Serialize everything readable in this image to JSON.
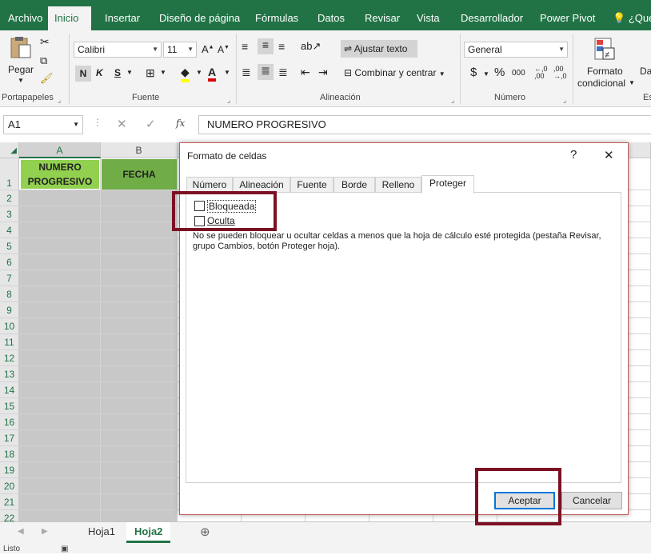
{
  "ribbon": {
    "tabs": [
      "Archivo",
      "Inicio",
      "Insertar",
      "Diseño de página",
      "Fórmulas",
      "Datos",
      "Revisar",
      "Vista",
      "Desarrollador",
      "Power Pivot",
      "¿Qué"
    ],
    "active_tab": "Inicio",
    "clipboard": {
      "paste_label": "Pegar",
      "group": "Portapapeles"
    },
    "font": {
      "name": "Calibri",
      "size": "11",
      "bold": "N",
      "italic": "K",
      "underline": "S",
      "group": "Fuente"
    },
    "alignment": {
      "wrap_text": "Ajustar texto",
      "merge_center": "Combinar y centrar",
      "group": "Alineación"
    },
    "number": {
      "format": "General",
      "currency": "$",
      "percent": "%",
      "thousands": "000",
      "inc_decimal": ",0\n,00",
      "group": "Número"
    },
    "styles": {
      "cond_format_1": "Formato",
      "cond_format_2": "condicional",
      "next_1": "Da",
      "next_group": "Es"
    }
  },
  "formula_bar": {
    "name_box": "A1",
    "fx": "fx",
    "value": "NUMERO PROGRESIVO"
  },
  "grid": {
    "columns": [
      "A",
      "B"
    ],
    "rows": [
      "1",
      "2",
      "3",
      "4",
      "5",
      "6",
      "7",
      "8",
      "9",
      "10",
      "11",
      "12",
      "13",
      "14",
      "15",
      "16",
      "17",
      "18",
      "19",
      "20",
      "21",
      "22"
    ],
    "a1": "NUMERO PROGRESIVO",
    "b1": "FECHA"
  },
  "sheets": {
    "tabs": [
      "Hoja1",
      "Hoja2"
    ],
    "active": "Hoja2",
    "status": "Listo"
  },
  "dialog": {
    "title": "Formato de celdas",
    "help": "?",
    "close": "✕",
    "tabs": [
      "Número",
      "Alineación",
      "Fuente",
      "Borde",
      "Relleno",
      "Proteger"
    ],
    "active_tab": "Proteger",
    "locked_label": "Bloqueada",
    "hidden_label": "Oculta",
    "note": "No se pueden bloquear u ocultar celdas a menos que la hoja de cálculo esté protegida (pestaña Revisar, grupo Cambios, botón Proteger hoja).",
    "ok": "Aceptar",
    "cancel": "Cancelar"
  },
  "colors": {
    "excel_green": "#217346",
    "highlight": "#7b1123",
    "a1_fill": "#92d050",
    "b1_fill": "#70ad47"
  }
}
